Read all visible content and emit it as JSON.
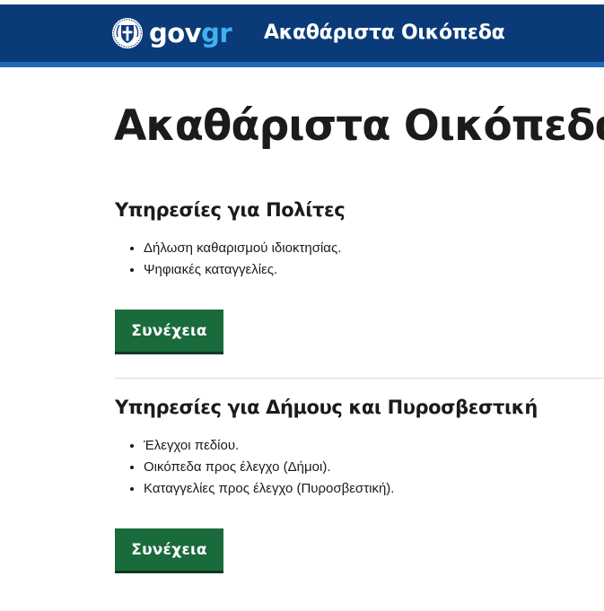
{
  "header": {
    "logo": {
      "gov": "gov",
      "gr": "gr"
    },
    "emblem_icon": "greek-emblem-icon",
    "title": "Ακαθάριστα Οικόπεδα",
    "colors": {
      "background": "#0b3a78",
      "accent_bar": "#1d6bb5",
      "logo_gr": "#3fb1f2"
    }
  },
  "main": {
    "title": "Ακαθάριστα Οικόπεδα",
    "sections": [
      {
        "title": "Υπηρεσίες για Πολίτες",
        "items": [
          "Δήλωση καθαρισμού ιδιοκτησίας.",
          "Ψηφιακές καταγγελίες."
        ],
        "button_label": "Συνέχεια"
      },
      {
        "title": "Υπηρεσίες για Δήμους και Πυροσβεστική",
        "items": [
          "Έλεγχοι πεδίου.",
          "Οικόπεδα προς έλεγχο (Δήμοι).",
          "Καταγγελίες προς έλεγχο (Πυροσβεστική)."
        ],
        "button_label": "Συνέχεια"
      }
    ],
    "colors": {
      "button": "#1a6b3c",
      "text": "#1b1b1b"
    }
  }
}
